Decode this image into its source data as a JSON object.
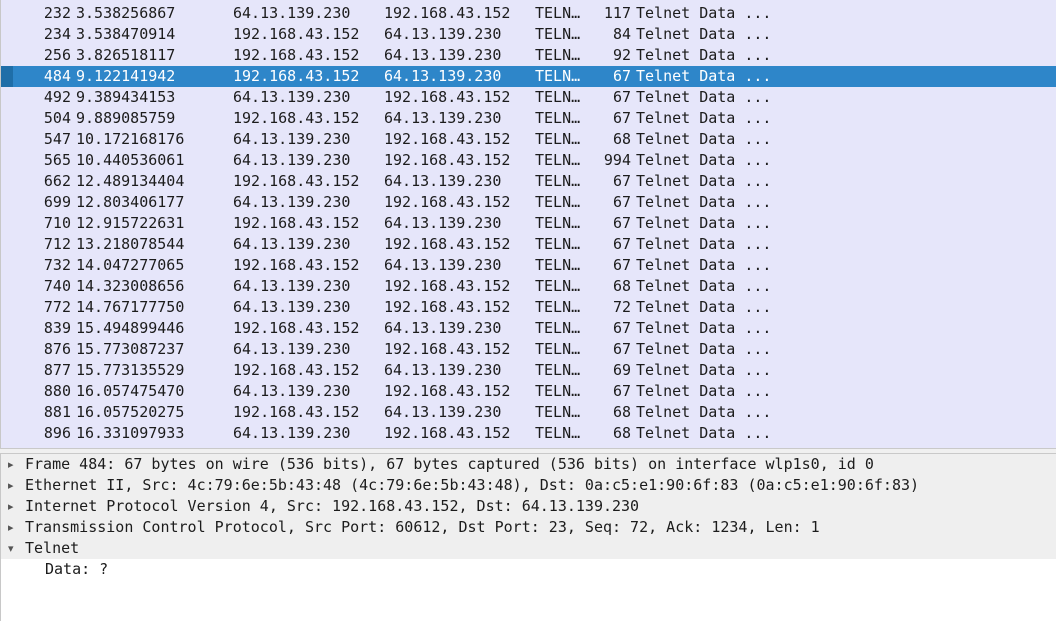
{
  "packets": [
    {
      "no": "232",
      "time": "3.538256867",
      "src": "64.13.139.230",
      "dst": "192.168.43.152",
      "proto": "TELN…",
      "len": "117",
      "info": "Telnet Data ..."
    },
    {
      "no": "234",
      "time": "3.538470914",
      "src": "192.168.43.152",
      "dst": "64.13.139.230",
      "proto": "TELN…",
      "len": "84",
      "info": "Telnet Data ..."
    },
    {
      "no": "256",
      "time": "3.826518117",
      "src": "192.168.43.152",
      "dst": "64.13.139.230",
      "proto": "TELN…",
      "len": "92",
      "info": "Telnet Data ..."
    },
    {
      "no": "484",
      "time": "9.122141942",
      "src": "192.168.43.152",
      "dst": "64.13.139.230",
      "proto": "TELN…",
      "len": "67",
      "info": "Telnet Data ...",
      "selected": true
    },
    {
      "no": "492",
      "time": "9.389434153",
      "src": "64.13.139.230",
      "dst": "192.168.43.152",
      "proto": "TELN…",
      "len": "67",
      "info": "Telnet Data ..."
    },
    {
      "no": "504",
      "time": "9.889085759",
      "src": "192.168.43.152",
      "dst": "64.13.139.230",
      "proto": "TELN…",
      "len": "67",
      "info": "Telnet Data ..."
    },
    {
      "no": "547",
      "time": "10.172168176",
      "src": "64.13.139.230",
      "dst": "192.168.43.152",
      "proto": "TELN…",
      "len": "68",
      "info": "Telnet Data ..."
    },
    {
      "no": "565",
      "time": "10.440536061",
      "src": "64.13.139.230",
      "dst": "192.168.43.152",
      "proto": "TELN…",
      "len": "994",
      "info": "Telnet Data ..."
    },
    {
      "no": "662",
      "time": "12.489134404",
      "src": "192.168.43.152",
      "dst": "64.13.139.230",
      "proto": "TELN…",
      "len": "67",
      "info": "Telnet Data ..."
    },
    {
      "no": "699",
      "time": "12.803406177",
      "src": "64.13.139.230",
      "dst": "192.168.43.152",
      "proto": "TELN…",
      "len": "67",
      "info": "Telnet Data ..."
    },
    {
      "no": "710",
      "time": "12.915722631",
      "src": "192.168.43.152",
      "dst": "64.13.139.230",
      "proto": "TELN…",
      "len": "67",
      "info": "Telnet Data ..."
    },
    {
      "no": "712",
      "time": "13.218078544",
      "src": "64.13.139.230",
      "dst": "192.168.43.152",
      "proto": "TELN…",
      "len": "67",
      "info": "Telnet Data ..."
    },
    {
      "no": "732",
      "time": "14.047277065",
      "src": "192.168.43.152",
      "dst": "64.13.139.230",
      "proto": "TELN…",
      "len": "67",
      "info": "Telnet Data ..."
    },
    {
      "no": "740",
      "time": "14.323008656",
      "src": "64.13.139.230",
      "dst": "192.168.43.152",
      "proto": "TELN…",
      "len": "68",
      "info": "Telnet Data ..."
    },
    {
      "no": "772",
      "time": "14.767177750",
      "src": "64.13.139.230",
      "dst": "192.168.43.152",
      "proto": "TELN…",
      "len": "72",
      "info": "Telnet Data ..."
    },
    {
      "no": "839",
      "time": "15.494899446",
      "src": "192.168.43.152",
      "dst": "64.13.139.230",
      "proto": "TELN…",
      "len": "67",
      "info": "Telnet Data ..."
    },
    {
      "no": "876",
      "time": "15.773087237",
      "src": "64.13.139.230",
      "dst": "192.168.43.152",
      "proto": "TELN…",
      "len": "67",
      "info": "Telnet Data ..."
    },
    {
      "no": "877",
      "time": "15.773135529",
      "src": "192.168.43.152",
      "dst": "64.13.139.230",
      "proto": "TELN…",
      "len": "69",
      "info": "Telnet Data ..."
    },
    {
      "no": "880",
      "time": "16.057475470",
      "src": "64.13.139.230",
      "dst": "192.168.43.152",
      "proto": "TELN…",
      "len": "67",
      "info": "Telnet Data ..."
    },
    {
      "no": "881",
      "time": "16.057520275",
      "src": "192.168.43.152",
      "dst": "64.13.139.230",
      "proto": "TELN…",
      "len": "68",
      "info": "Telnet Data ..."
    },
    {
      "no": "896",
      "time": "16.331097933",
      "src": "64.13.139.230",
      "dst": "192.168.43.152",
      "proto": "TELN…",
      "len": "68",
      "info": "Telnet Data ..."
    }
  ],
  "details": [
    {
      "text": "Frame 484: 67 bytes on wire (536 bits), 67 bytes captured (536 bits) on interface wlp1s0, id 0",
      "expanded": false,
      "icon": "chevron-right-icon"
    },
    {
      "text": "Ethernet II, Src: 4c:79:6e:5b:43:48 (4c:79:6e:5b:43:48), Dst: 0a:c5:e1:90:6f:83 (0a:c5:e1:90:6f:83)",
      "expanded": false,
      "icon": "chevron-right-icon"
    },
    {
      "text": "Internet Protocol Version 4, Src: 192.168.43.152, Dst: 64.13.139.230",
      "expanded": false,
      "icon": "chevron-right-icon"
    },
    {
      "text": "Transmission Control Protocol, Src Port: 60612, Dst Port: 23, Seq: 72, Ack: 1234, Len: 1",
      "expanded": false,
      "icon": "chevron-right-icon"
    },
    {
      "text": "Telnet",
      "expanded": true,
      "icon": "chevron-down-icon"
    },
    {
      "text": "Data: ?",
      "child": true
    }
  ],
  "colors": {
    "selected_row": "#2e86c9",
    "list_background": "#e6e6fa"
  }
}
